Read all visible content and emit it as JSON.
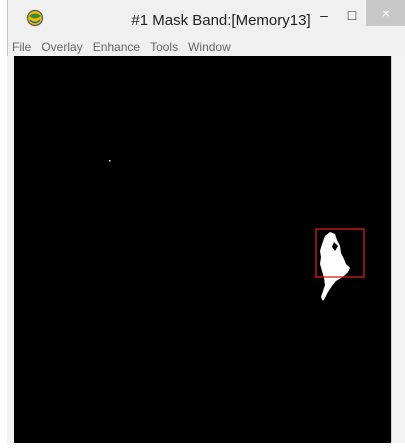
{
  "window": {
    "title": "#1 Mask Band:[Memory13]"
  },
  "controls": {
    "minimize": "–",
    "maximize": "□",
    "close": "×"
  },
  "menu": {
    "items": [
      {
        "label": "File"
      },
      {
        "label": "Overlay"
      },
      {
        "label": "Enhance"
      },
      {
        "label": "Tools"
      },
      {
        "label": "Window"
      }
    ]
  },
  "colors": {
    "canvas_background": "#000000",
    "mask_foreground": "#ffffff",
    "zoom_box": "#d42020",
    "close_button": "#c7c7c7"
  },
  "icons": {
    "app": "envi-globe-icon"
  }
}
